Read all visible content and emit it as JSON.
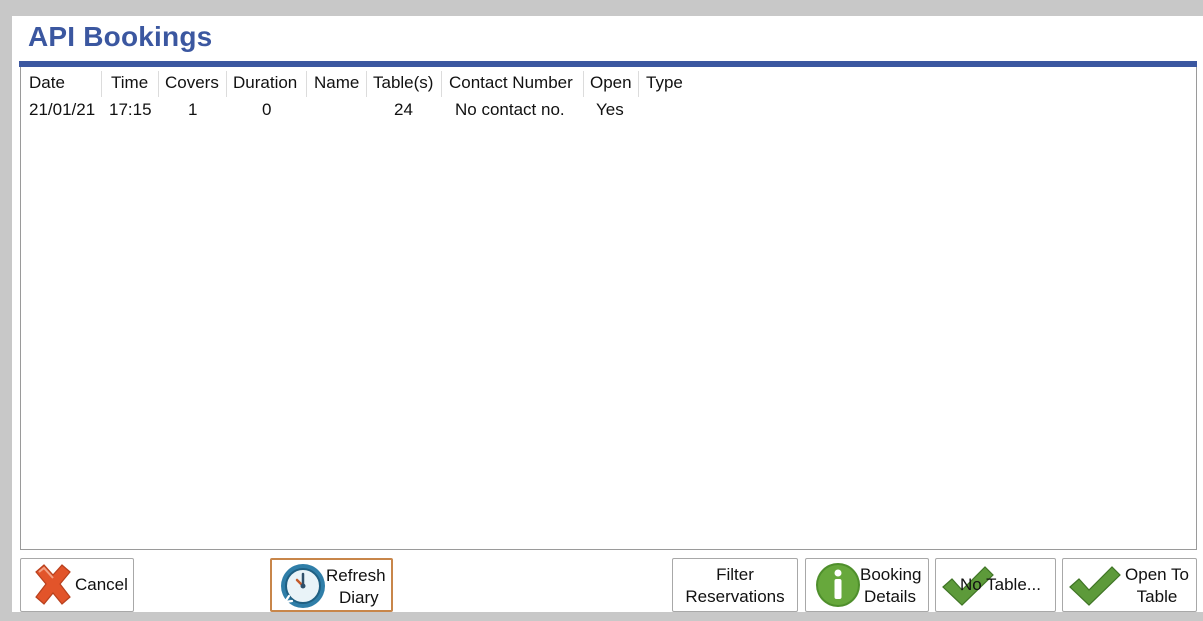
{
  "window": {
    "title": "API Bookings"
  },
  "columns": [
    "Date",
    "Time",
    "Covers",
    "Duration",
    "Name",
    "Table(s)",
    "Contact Number",
    "Open",
    "Type"
  ],
  "rows": [
    {
      "date": "21/01/21",
      "time": "17:15",
      "covers": "1",
      "duration": "0",
      "name": "",
      "tables": "24",
      "contact": "No contact no.",
      "open": "Yes",
      "type": ""
    }
  ],
  "buttons": {
    "cancel": "Cancel",
    "refresh_line1": "Refresh",
    "refresh_line2": "Diary",
    "filter_line1": "Filter",
    "filter_line2": "Reservations",
    "details_line1": "Booking",
    "details_line2": "Details",
    "no_table": "No Table...",
    "open_line1": "Open To",
    "open_line2": "Table"
  },
  "icons": {
    "cancel": "cross-icon",
    "refresh": "clock-refresh-icon",
    "details": "info-icon",
    "no_table": "checkmark-icon",
    "open": "checkmark-icon"
  },
  "colors": {
    "accent": "#3b57a0",
    "cancel_red": "#e2542a",
    "check_green": "#5d9a3a",
    "info_green": "#4f8f2c"
  }
}
